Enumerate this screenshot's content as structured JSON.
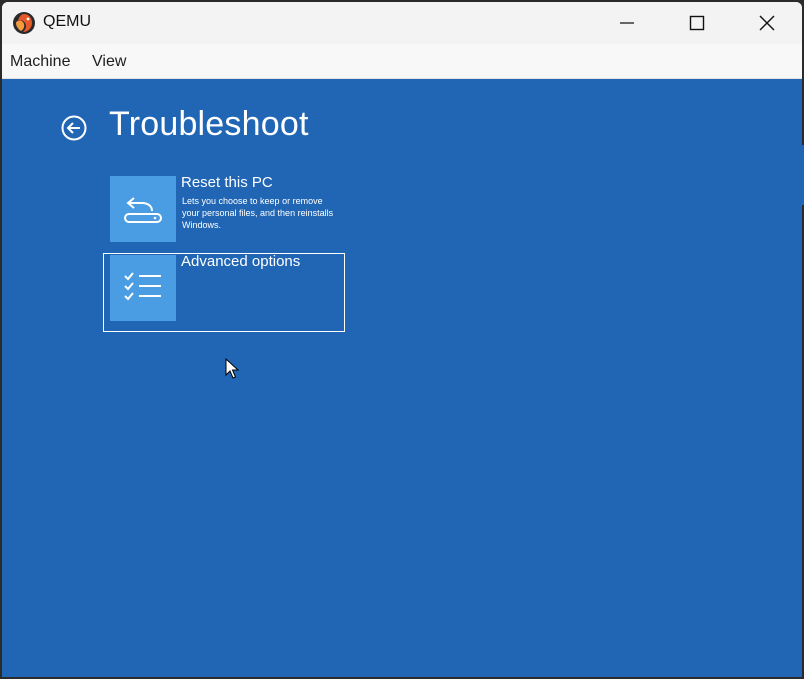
{
  "window": {
    "title": "QEMU",
    "minimize_icon": "minimize-icon",
    "maximize_icon": "maximize-icon",
    "close_icon": "close-icon"
  },
  "menu": {
    "items": [
      {
        "label": "Machine"
      },
      {
        "label": "View"
      }
    ]
  },
  "screen": {
    "background": "#2066b4",
    "back_icon": "back-arrow-circle-icon",
    "title": "Troubleshoot",
    "options": [
      {
        "title": "Reset this PC",
        "description": "Lets you choose to keep or remove your personal files, and then reinstalls Windows.",
        "icon": "reset-pc-icon",
        "selected": false
      },
      {
        "title": "Advanced options",
        "description": "",
        "icon": "checklist-icon",
        "selected": true
      }
    ],
    "tile_color": "#4a9de3"
  }
}
